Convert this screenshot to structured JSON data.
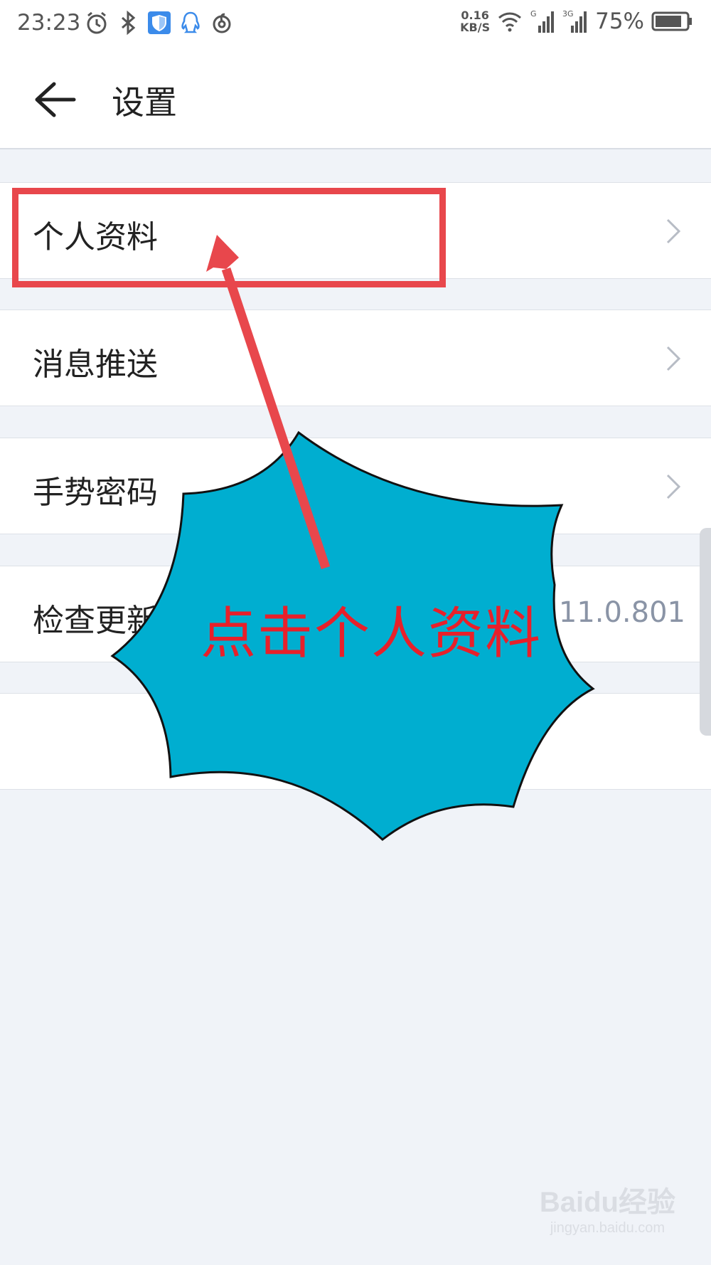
{
  "status_bar": {
    "time": "23:23",
    "left_icons": [
      "alarm-icon",
      "bluetooth-icon",
      "shield-icon",
      "qq-icon",
      "netease-music-icon"
    ],
    "net_speed_value": "0.16",
    "net_speed_unit": "KB/S",
    "signal_label_1": "G",
    "signal_label_2": "3G",
    "battery_percent": "75%"
  },
  "header": {
    "title": "设置",
    "back_icon": "back-arrow-icon"
  },
  "settings": {
    "items": [
      {
        "label": "个人资料",
        "trailing": "chevron"
      },
      {
        "label": "消息推送",
        "trailing": "chevron"
      },
      {
        "label": "手势密码",
        "trailing": "chevron"
      },
      {
        "label": "检查更新",
        "value": "2.11.0.801"
      }
    ]
  },
  "annotation": {
    "callout_text": "点击个人资料",
    "callout_color": "#00aed0",
    "arrow_color": "#e8474c",
    "text_color": "#e8202a"
  },
  "watermark": {
    "logo": "Baidu经验",
    "url": "jingyan.baidu.com"
  }
}
